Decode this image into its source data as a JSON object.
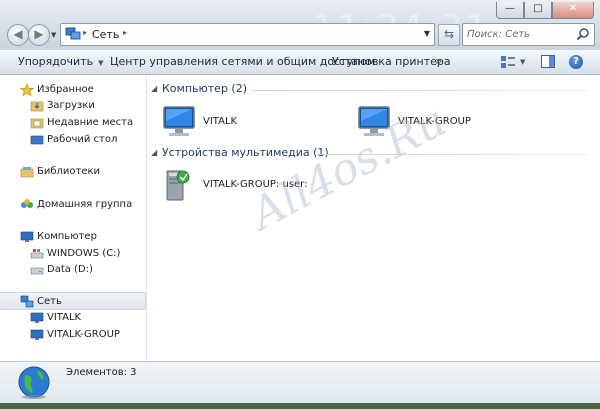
{
  "window": {
    "caption_buttons": {
      "minimize": "—",
      "maximize": "□",
      "close": "✕"
    },
    "watermark_numbers": "11:34:31"
  },
  "address_bar": {
    "back_glyph": "◀",
    "forward_glyph": "▶",
    "crumb_separator": "▸",
    "location": "Сеть",
    "dropdown_glyph": "▼",
    "refresh_glyph": "⇆"
  },
  "search": {
    "placeholder": "Поиск: Сеть"
  },
  "toolbar": {
    "organize": "Упорядочить",
    "network_center": "Центр управления сетями и общим доступом",
    "install_printer": "Установка принтера",
    "more": "»",
    "dropdown_glyph": "▼",
    "help": "?"
  },
  "nav": {
    "favorites": "Избранное",
    "downloads": "Загрузки",
    "recent": "Недавние места",
    "desktop": "Рабочий стол",
    "libraries": "Библиотеки",
    "homegroup": "Домашняя группа",
    "computer": "Компьютер",
    "drive_c": "WINDOWS (C:)",
    "drive_d": "Data (D:)",
    "network": "Сеть",
    "net_vitalk": "VITALK",
    "net_group": "VITALK-GROUP"
  },
  "content": {
    "group_computers": "Компьютер (2)",
    "group_media": "Устройства мультимедиа (1)",
    "collapse_glyph": "◢",
    "computers": [
      {
        "name": "VITALK"
      },
      {
        "name": "VITALK-GROUP"
      }
    ],
    "media": [
      {
        "name": "VITALK-GROUP: user:"
      }
    ],
    "site_watermark": "All4os.Ru"
  },
  "status": {
    "items_count": "Элементов: 3"
  },
  "icons": {
    "monitor": "monitor-icon",
    "media_server": "media-server-icon",
    "star": "star-icon",
    "globe": "globe-icon"
  }
}
